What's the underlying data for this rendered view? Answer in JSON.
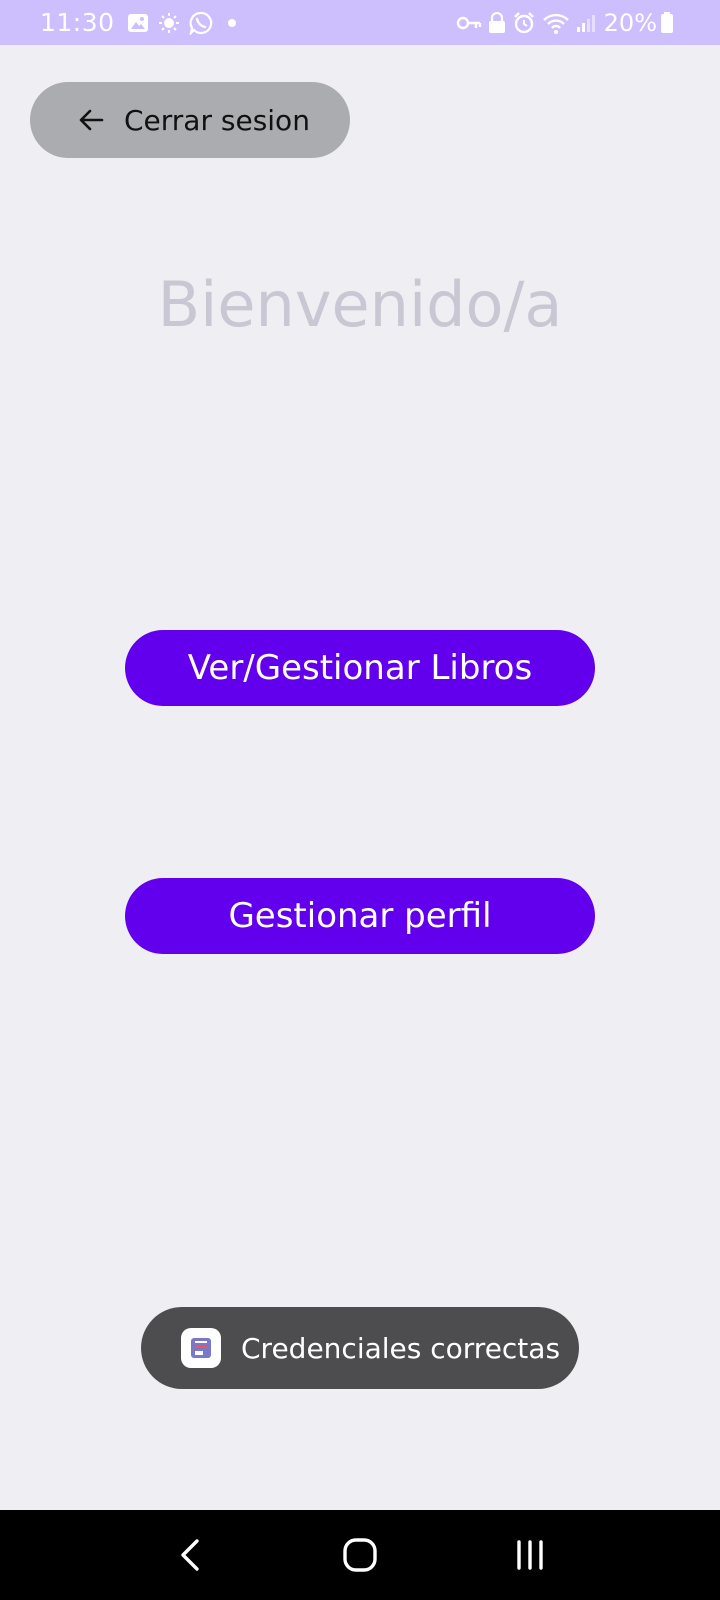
{
  "status_bar": {
    "time": "11:30",
    "left_icons": [
      "gallery-icon",
      "brightness-icon",
      "whatsapp-icon",
      "dot-icon"
    ],
    "right_icons": [
      "vpn-key-icon",
      "lock-icon",
      "alarm-icon",
      "wifi-icon",
      "signal-icon"
    ],
    "battery": "20%",
    "background": "#cdbefe"
  },
  "header": {
    "logout_label": "Cerrar sesion"
  },
  "main": {
    "welcome_title": "Bienvenido/a",
    "books_button_label": "Ver/Gestionar Libros",
    "profile_button_label": "Gestionar perfil",
    "accent_color": "#6200ee"
  },
  "toast": {
    "message": "Credenciales correctas"
  },
  "nav_bar": {
    "buttons": [
      "back-icon",
      "home-icon",
      "recents-icon"
    ]
  }
}
